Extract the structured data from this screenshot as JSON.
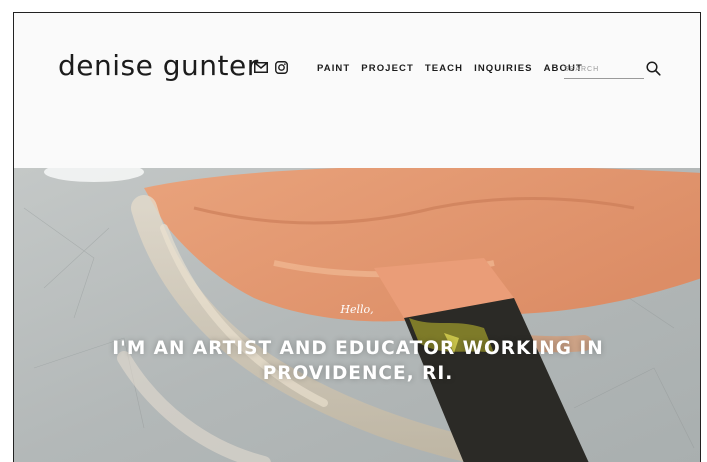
{
  "brand": {
    "name": "denise gunter"
  },
  "social": {
    "icons": [
      "mail-icon",
      "instagram-icon"
    ]
  },
  "nav": {
    "items": [
      "PAINT",
      "PROJECT",
      "TEACH",
      "INQUIRIES",
      "ABOUT"
    ]
  },
  "search": {
    "placeholder": "SEARCH",
    "value": ""
  },
  "hero": {
    "greeting": "Hello,",
    "headline": "I'M AN ARTIST AND EDUCATOR WORKING IN PROVIDENCE, RI."
  },
  "colors": {
    "text": "#1c1c1c",
    "header_bg": "#fafafa",
    "paint_orange": "#e8a07a",
    "concrete_gray": "#b8bcbc",
    "hero_text": "#ffffff"
  }
}
